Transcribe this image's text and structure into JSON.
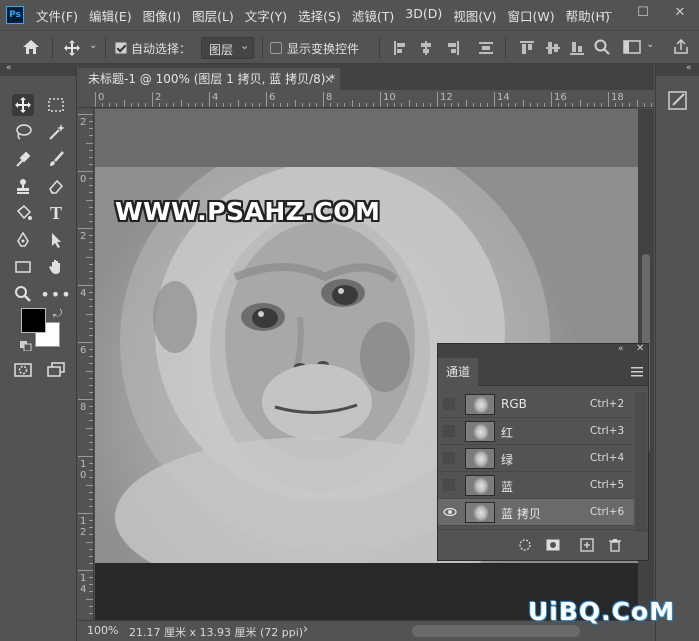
{
  "app": {
    "logo": "Ps"
  },
  "menu": [
    "文件(F)",
    "编辑(E)",
    "图像(I)",
    "图层(L)",
    "文字(Y)",
    "选择(S)",
    "滤镜(T)",
    "3D(D)",
    "视图(V)",
    "窗口(W)",
    "帮助(H)"
  ],
  "window_controls": {
    "minimize": "—",
    "maximize": "☐",
    "close": "✕"
  },
  "options_bar": {
    "auto_select_label": "自动选择：",
    "auto_select_checked": true,
    "auto_select_target": "图层",
    "show_transform_label": "显示变换控件",
    "show_transform_checked": false
  },
  "document": {
    "tab_title": "未标题-1 @ 100% (图层 1 拷贝, 蓝 拷贝/8) *",
    "close": "×"
  },
  "ruler": {
    "top_labels": [
      "0",
      "2",
      "4",
      "6",
      "8",
      "10",
      "12",
      "14",
      "16",
      "18"
    ],
    "left_labels": [
      "2",
      "0",
      "2",
      "4",
      "6",
      "8",
      "1\n0",
      "1\n2",
      "1\n4"
    ]
  },
  "canvas": {
    "watermark": "WWW.PSAHZ.COM"
  },
  "status": {
    "zoom": "100%",
    "doc_info": "21.17 厘米 x 13.93 厘米 (72 ppi)",
    "arrow": "›"
  },
  "panel_collapse": {
    "left": "«",
    "right": "«"
  },
  "channels_panel": {
    "tab": "通道",
    "channels": [
      {
        "name": "RGB",
        "shortcut": "Ctrl+2",
        "visible": false,
        "selected": false
      },
      {
        "name": "红",
        "shortcut": "Ctrl+3",
        "visible": false,
        "selected": false
      },
      {
        "name": "绿",
        "shortcut": "Ctrl+4",
        "visible": false,
        "selected": false
      },
      {
        "name": "蓝",
        "shortcut": "Ctrl+5",
        "visible": false,
        "selected": false
      },
      {
        "name": "蓝 拷贝",
        "shortcut": "Ctrl+6",
        "visible": true,
        "selected": true
      }
    ]
  },
  "footer_watermark": "UiBQ.CoM",
  "colors": {
    "accent": "#31a8ff",
    "panel": "#535353",
    "dark": "#424242",
    "foreground_swatch": "#000000",
    "background_swatch": "#ffffff"
  }
}
